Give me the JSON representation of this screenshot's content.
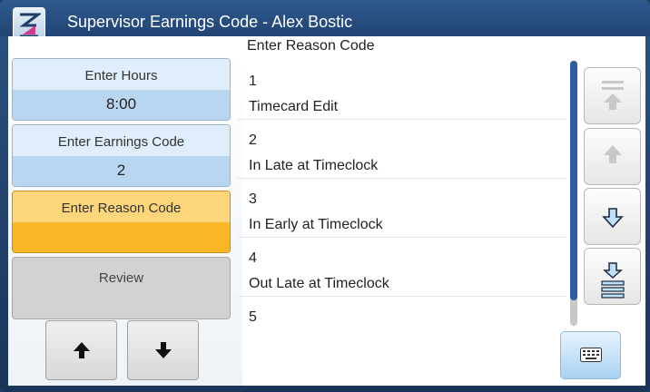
{
  "window": {
    "title": "Supervisor Earnings Code - Alex Bostic",
    "logo_icon": "hourglass-icon"
  },
  "steps": [
    {
      "label": "Enter Hours",
      "value": "8:00",
      "state": "done"
    },
    {
      "label": "Enter Earnings Code",
      "value": "2",
      "state": "done"
    },
    {
      "label": "Enter Reason Code",
      "value": "",
      "state": "active"
    },
    {
      "label": "Review",
      "value": "",
      "state": "pending"
    }
  ],
  "nav": {
    "up_icon": "arrow-up-icon",
    "down_icon": "arrow-down-icon"
  },
  "list": {
    "header": "Enter Reason Code",
    "items": [
      {
        "code": "1",
        "label": "Timecard Edit"
      },
      {
        "code": "2",
        "label": "In Late at Timeclock"
      },
      {
        "code": "3",
        "label": "In Early at Timeclock"
      },
      {
        "code": "4",
        "label": "Out Late at Timeclock"
      },
      {
        "code": "5",
        "label": ""
      }
    ]
  },
  "scroll_buttons": [
    "scroll-top-icon",
    "scroll-up-icon",
    "scroll-down-icon",
    "scroll-bottom-icon"
  ],
  "keyboard_icon": "keyboard-icon",
  "colors": {
    "active": "#fbb628",
    "done": "#b8d6ef",
    "titlebar": "#2f5a8e",
    "scroll_thumb": "#2d5fa0"
  }
}
